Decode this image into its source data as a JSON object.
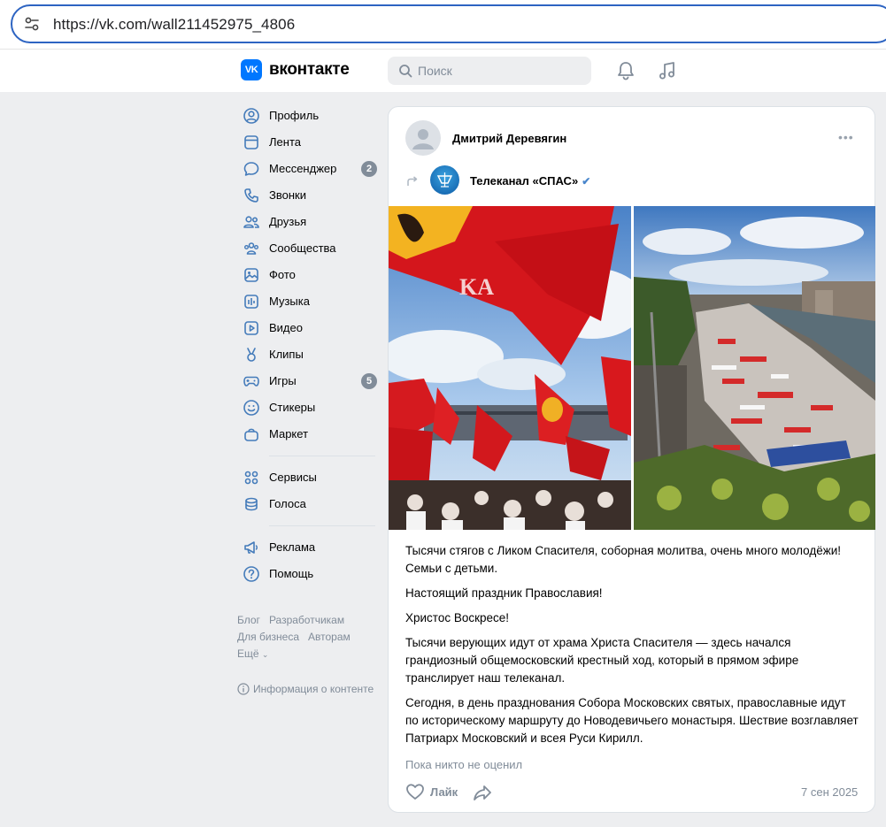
{
  "browser": {
    "url": "https://vk.com/wall211452975_4806"
  },
  "header": {
    "logo_mark": "VK",
    "logo_text": "вконтакте",
    "search_placeholder": "Поиск"
  },
  "sidebar": {
    "items": [
      {
        "label": "Профиль",
        "icon": "profile-icon"
      },
      {
        "label": "Лента",
        "icon": "feed-icon"
      },
      {
        "label": "Мессенджер",
        "icon": "messenger-icon",
        "badge": "2"
      },
      {
        "label": "Звонки",
        "icon": "phone-icon"
      },
      {
        "label": "Друзья",
        "icon": "friends-icon"
      },
      {
        "label": "Сообщества",
        "icon": "communities-icon"
      },
      {
        "label": "Фото",
        "icon": "photo-icon"
      },
      {
        "label": "Музыка",
        "icon": "music-icon"
      },
      {
        "label": "Видео",
        "icon": "video-icon"
      },
      {
        "label": "Клипы",
        "icon": "clips-icon"
      },
      {
        "label": "Игры",
        "icon": "games-icon",
        "badge": "5"
      },
      {
        "label": "Стикеры",
        "icon": "stickers-icon"
      },
      {
        "label": "Маркет",
        "icon": "market-icon"
      }
    ],
    "items2": [
      {
        "label": "Сервисы",
        "icon": "services-icon"
      },
      {
        "label": "Голоса",
        "icon": "votes-icon"
      }
    ],
    "items3": [
      {
        "label": "Реклама",
        "icon": "ads-icon"
      },
      {
        "label": "Помощь",
        "icon": "help-icon"
      }
    ],
    "footer": {
      "blog": "Блог",
      "developers": "Разработчикам",
      "business": "Для бизнеса",
      "authors": "Авторам",
      "more": "Ещё"
    },
    "content_info": "Информация о контенте"
  },
  "post": {
    "author": "Дмитрий Деревягин",
    "more": "•••",
    "channel": "Телеканал «СПАС»",
    "paragraphs": [
      "Тысячи стягов с Ликом Спасителя, соборная молитва, очень много молодёжи! Семьи с детьми.",
      "Настоящий праздник Православия!",
      "Христос Воскресе!",
      "Тысячи верующих идут от храма Христа Спасителя — здесь начался грандиозный общемосковский крестный ход, который в прямом эфире транслирует наш телеканал.",
      "Сегодня, в день празднования Собора Московских святых, православные идут по историческому маршруту до Новодевичьего монастыря. Шествие возглавляет Патриарх Московский и всея Руси Кирилл."
    ],
    "likes_text": "Пока никто не оценил",
    "like_label": "Лайк",
    "date": "7 сен 2025"
  },
  "colors": {
    "accent": "#0077ff",
    "page_bg": "#edeef0",
    "muted": "#818c99",
    "verified": "#4986cc"
  }
}
